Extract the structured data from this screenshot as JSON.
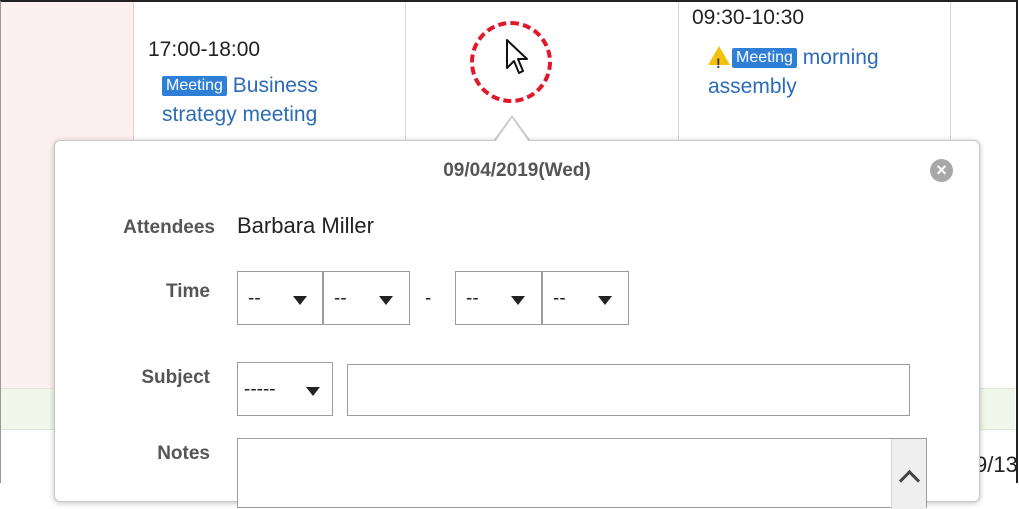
{
  "calendar": {
    "events": [
      {
        "time": "17:00-18:00",
        "badge": "Meeting",
        "title_line1": "Business",
        "title_line2": "strategy meeting"
      },
      {
        "time": "09:30-10:30",
        "badge": "Meeting",
        "title_line1": "morning",
        "title_line2": "assembly",
        "warning_icon": "warning-icon"
      }
    ],
    "partial_date": "9/13",
    "top_cut_text": "..."
  },
  "popup": {
    "date": "09/04/2019(Wed)",
    "close_icon": "close-icon",
    "attendees_label": "Attendees",
    "attendees_value": "Barbara Miller",
    "time_label": "Time",
    "time_start_hour": "--",
    "time_start_minute": "--",
    "time_separator": "-",
    "time_end_hour": "--",
    "time_end_minute": "--",
    "subject_label": "Subject",
    "subject_menu": "-----",
    "subject_value": "",
    "notes_label": "Notes",
    "notes_value": ""
  },
  "colors": {
    "link": "#2b6cb8",
    "badge": "#2f7fd6",
    "highlight_circle": "#e0182a"
  }
}
